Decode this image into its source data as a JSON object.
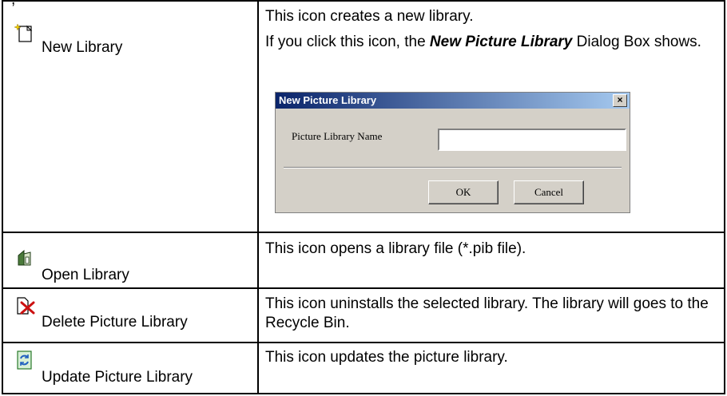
{
  "header_fragment": ", ",
  "rows": [
    {
      "label": "New Library",
      "icon": "new-library-icon",
      "desc_line1": "This icon creates a new library.",
      "desc_line2_prefix": "If you click this icon, the ",
      "desc_line2_emph": "New Picture Library",
      "desc_line2_suffix": " Dialog Box shows."
    },
    {
      "label": "Open Library",
      "icon": "open-library-icon",
      "desc": "This icon opens a library file (*.pib file)."
    },
    {
      "label": "Delete Picture Library",
      "icon": "delete-library-icon",
      "desc": "This icon uninstalls the selected library. The library will goes to the Recycle Bin."
    },
    {
      "label": "Update Picture Library",
      "icon": "update-library-icon",
      "desc": "This icon updates the picture library."
    }
  ],
  "dialog": {
    "title": "New Picture Library",
    "close": "×",
    "field_label": "Picture Library Name",
    "field_value": "",
    "ok": "OK",
    "cancel": "Cancel"
  }
}
